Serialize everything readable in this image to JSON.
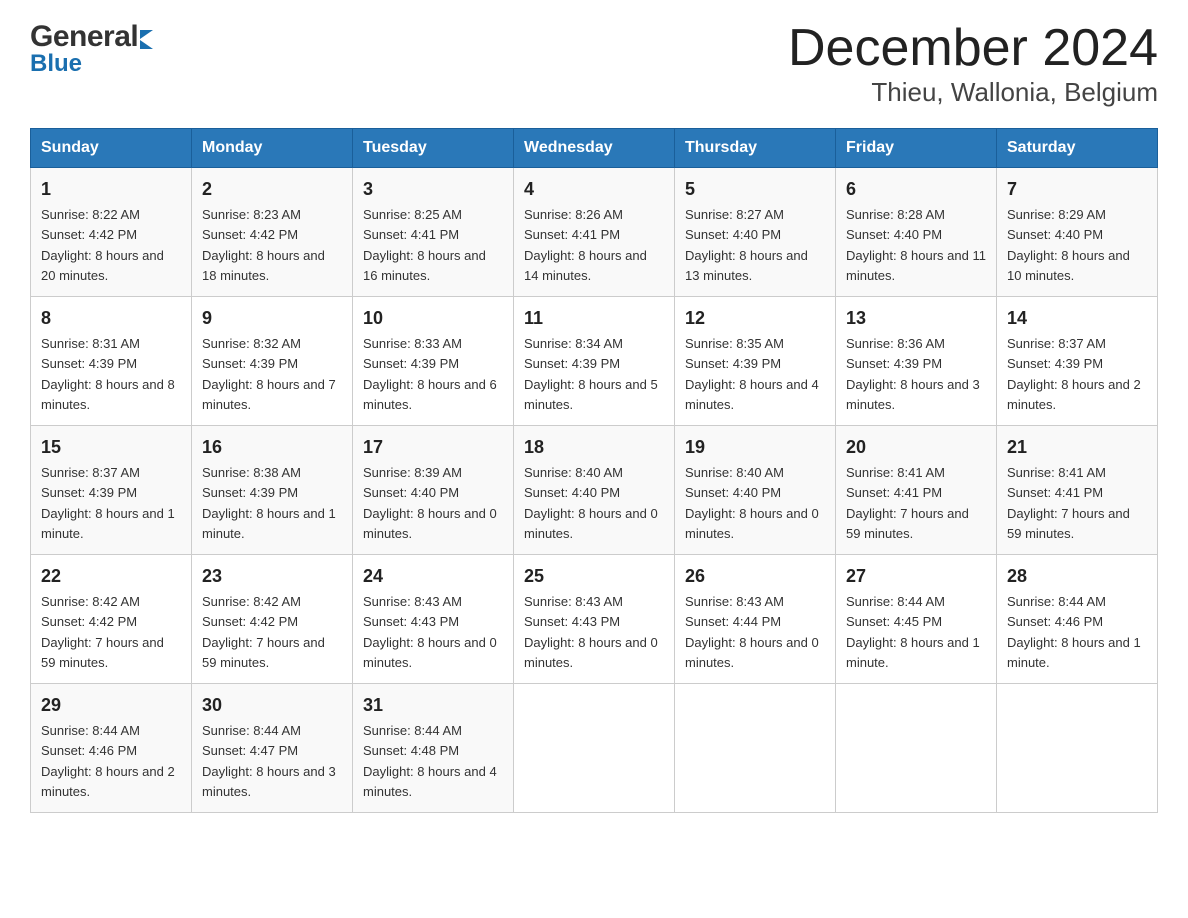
{
  "header": {
    "logo_general": "General",
    "logo_blue": "Blue",
    "month_title": "December 2024",
    "location": "Thieu, Wallonia, Belgium"
  },
  "days_of_week": [
    "Sunday",
    "Monday",
    "Tuesday",
    "Wednesday",
    "Thursday",
    "Friday",
    "Saturday"
  ],
  "weeks": [
    [
      {
        "day": "1",
        "sunrise": "8:22 AM",
        "sunset": "4:42 PM",
        "daylight": "8 hours and 20 minutes."
      },
      {
        "day": "2",
        "sunrise": "8:23 AM",
        "sunset": "4:42 PM",
        "daylight": "8 hours and 18 minutes."
      },
      {
        "day": "3",
        "sunrise": "8:25 AM",
        "sunset": "4:41 PM",
        "daylight": "8 hours and 16 minutes."
      },
      {
        "day": "4",
        "sunrise": "8:26 AM",
        "sunset": "4:41 PM",
        "daylight": "8 hours and 14 minutes."
      },
      {
        "day": "5",
        "sunrise": "8:27 AM",
        "sunset": "4:40 PM",
        "daylight": "8 hours and 13 minutes."
      },
      {
        "day": "6",
        "sunrise": "8:28 AM",
        "sunset": "4:40 PM",
        "daylight": "8 hours and 11 minutes."
      },
      {
        "day": "7",
        "sunrise": "8:29 AM",
        "sunset": "4:40 PM",
        "daylight": "8 hours and 10 minutes."
      }
    ],
    [
      {
        "day": "8",
        "sunrise": "8:31 AM",
        "sunset": "4:39 PM",
        "daylight": "8 hours and 8 minutes."
      },
      {
        "day": "9",
        "sunrise": "8:32 AM",
        "sunset": "4:39 PM",
        "daylight": "8 hours and 7 minutes."
      },
      {
        "day": "10",
        "sunrise": "8:33 AM",
        "sunset": "4:39 PM",
        "daylight": "8 hours and 6 minutes."
      },
      {
        "day": "11",
        "sunrise": "8:34 AM",
        "sunset": "4:39 PM",
        "daylight": "8 hours and 5 minutes."
      },
      {
        "day": "12",
        "sunrise": "8:35 AM",
        "sunset": "4:39 PM",
        "daylight": "8 hours and 4 minutes."
      },
      {
        "day": "13",
        "sunrise": "8:36 AM",
        "sunset": "4:39 PM",
        "daylight": "8 hours and 3 minutes."
      },
      {
        "day": "14",
        "sunrise": "8:37 AM",
        "sunset": "4:39 PM",
        "daylight": "8 hours and 2 minutes."
      }
    ],
    [
      {
        "day": "15",
        "sunrise": "8:37 AM",
        "sunset": "4:39 PM",
        "daylight": "8 hours and 1 minute."
      },
      {
        "day": "16",
        "sunrise": "8:38 AM",
        "sunset": "4:39 PM",
        "daylight": "8 hours and 1 minute."
      },
      {
        "day": "17",
        "sunrise": "8:39 AM",
        "sunset": "4:40 PM",
        "daylight": "8 hours and 0 minutes."
      },
      {
        "day": "18",
        "sunrise": "8:40 AM",
        "sunset": "4:40 PM",
        "daylight": "8 hours and 0 minutes."
      },
      {
        "day": "19",
        "sunrise": "8:40 AM",
        "sunset": "4:40 PM",
        "daylight": "8 hours and 0 minutes."
      },
      {
        "day": "20",
        "sunrise": "8:41 AM",
        "sunset": "4:41 PM",
        "daylight": "7 hours and 59 minutes."
      },
      {
        "day": "21",
        "sunrise": "8:41 AM",
        "sunset": "4:41 PM",
        "daylight": "7 hours and 59 minutes."
      }
    ],
    [
      {
        "day": "22",
        "sunrise": "8:42 AM",
        "sunset": "4:42 PM",
        "daylight": "7 hours and 59 minutes."
      },
      {
        "day": "23",
        "sunrise": "8:42 AM",
        "sunset": "4:42 PM",
        "daylight": "7 hours and 59 minutes."
      },
      {
        "day": "24",
        "sunrise": "8:43 AM",
        "sunset": "4:43 PM",
        "daylight": "8 hours and 0 minutes."
      },
      {
        "day": "25",
        "sunrise": "8:43 AM",
        "sunset": "4:43 PM",
        "daylight": "8 hours and 0 minutes."
      },
      {
        "day": "26",
        "sunrise": "8:43 AM",
        "sunset": "4:44 PM",
        "daylight": "8 hours and 0 minutes."
      },
      {
        "day": "27",
        "sunrise": "8:44 AM",
        "sunset": "4:45 PM",
        "daylight": "8 hours and 1 minute."
      },
      {
        "day": "28",
        "sunrise": "8:44 AM",
        "sunset": "4:46 PM",
        "daylight": "8 hours and 1 minute."
      }
    ],
    [
      {
        "day": "29",
        "sunrise": "8:44 AM",
        "sunset": "4:46 PM",
        "daylight": "8 hours and 2 minutes."
      },
      {
        "day": "30",
        "sunrise": "8:44 AM",
        "sunset": "4:47 PM",
        "daylight": "8 hours and 3 minutes."
      },
      {
        "day": "31",
        "sunrise": "8:44 AM",
        "sunset": "4:48 PM",
        "daylight": "8 hours and 4 minutes."
      },
      null,
      null,
      null,
      null
    ]
  ],
  "labels": {
    "sunrise": "Sunrise:",
    "sunset": "Sunset:",
    "daylight": "Daylight:"
  }
}
